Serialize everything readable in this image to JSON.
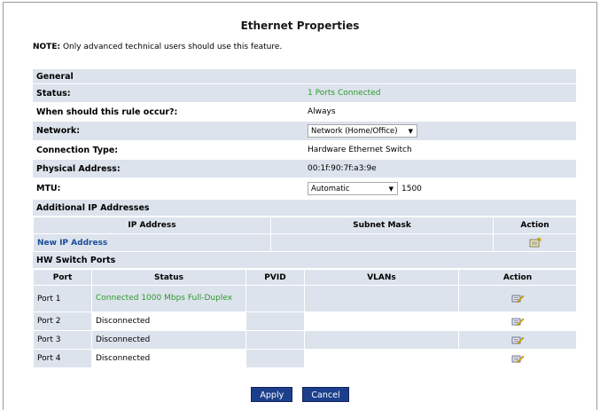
{
  "page": {
    "title": "Ethernet Properties",
    "note_prefix": "NOTE:",
    "note_text": " Only advanced technical users should use this feature."
  },
  "general": {
    "section_label": "General",
    "status_label": "Status:",
    "status_value": "1 Ports Connected",
    "rule_label": "When should this rule occur?:",
    "rule_value": "Always",
    "network_label": "Network:",
    "network_value": "Network (Home/Office)",
    "connection_label": "Connection Type:",
    "connection_value": "Hardware Ethernet Switch",
    "physical_label": "Physical Address:",
    "physical_value": "00:1f:90:7f:a3:9e",
    "mtu_label": "MTU:",
    "mtu_select": "Automatic",
    "mtu_value": "1500"
  },
  "additional_ip": {
    "section_label": "Additional IP Addresses",
    "headers": [
      "IP Address",
      "Subnet Mask",
      "Action"
    ],
    "new_link": "New IP Address"
  },
  "hw_ports": {
    "section_label": "HW Switch Ports",
    "headers": [
      "Port",
      "Status",
      "PVID",
      "VLANs",
      "Action"
    ],
    "rows": [
      {
        "port": "Port 1",
        "status": "Connected 1000 Mbps Full-Duplex",
        "connected": true
      },
      {
        "port": "Port 2",
        "status": "Disconnected",
        "connected": false
      },
      {
        "port": "Port 3",
        "status": "Disconnected",
        "connected": false
      },
      {
        "port": "Port 4",
        "status": "Disconnected",
        "connected": false
      }
    ]
  },
  "buttons": {
    "apply": "Apply",
    "cancel": "Cancel"
  },
  "colors": {
    "row_shade": "#dce3ec",
    "connected_green": "#2d9a2d",
    "link_blue": "#1a4c9a",
    "button_blue": "#1c3f8c"
  },
  "icons": {
    "edit": "edit-pencil-icon",
    "new_ip": "new-entry-icon"
  }
}
